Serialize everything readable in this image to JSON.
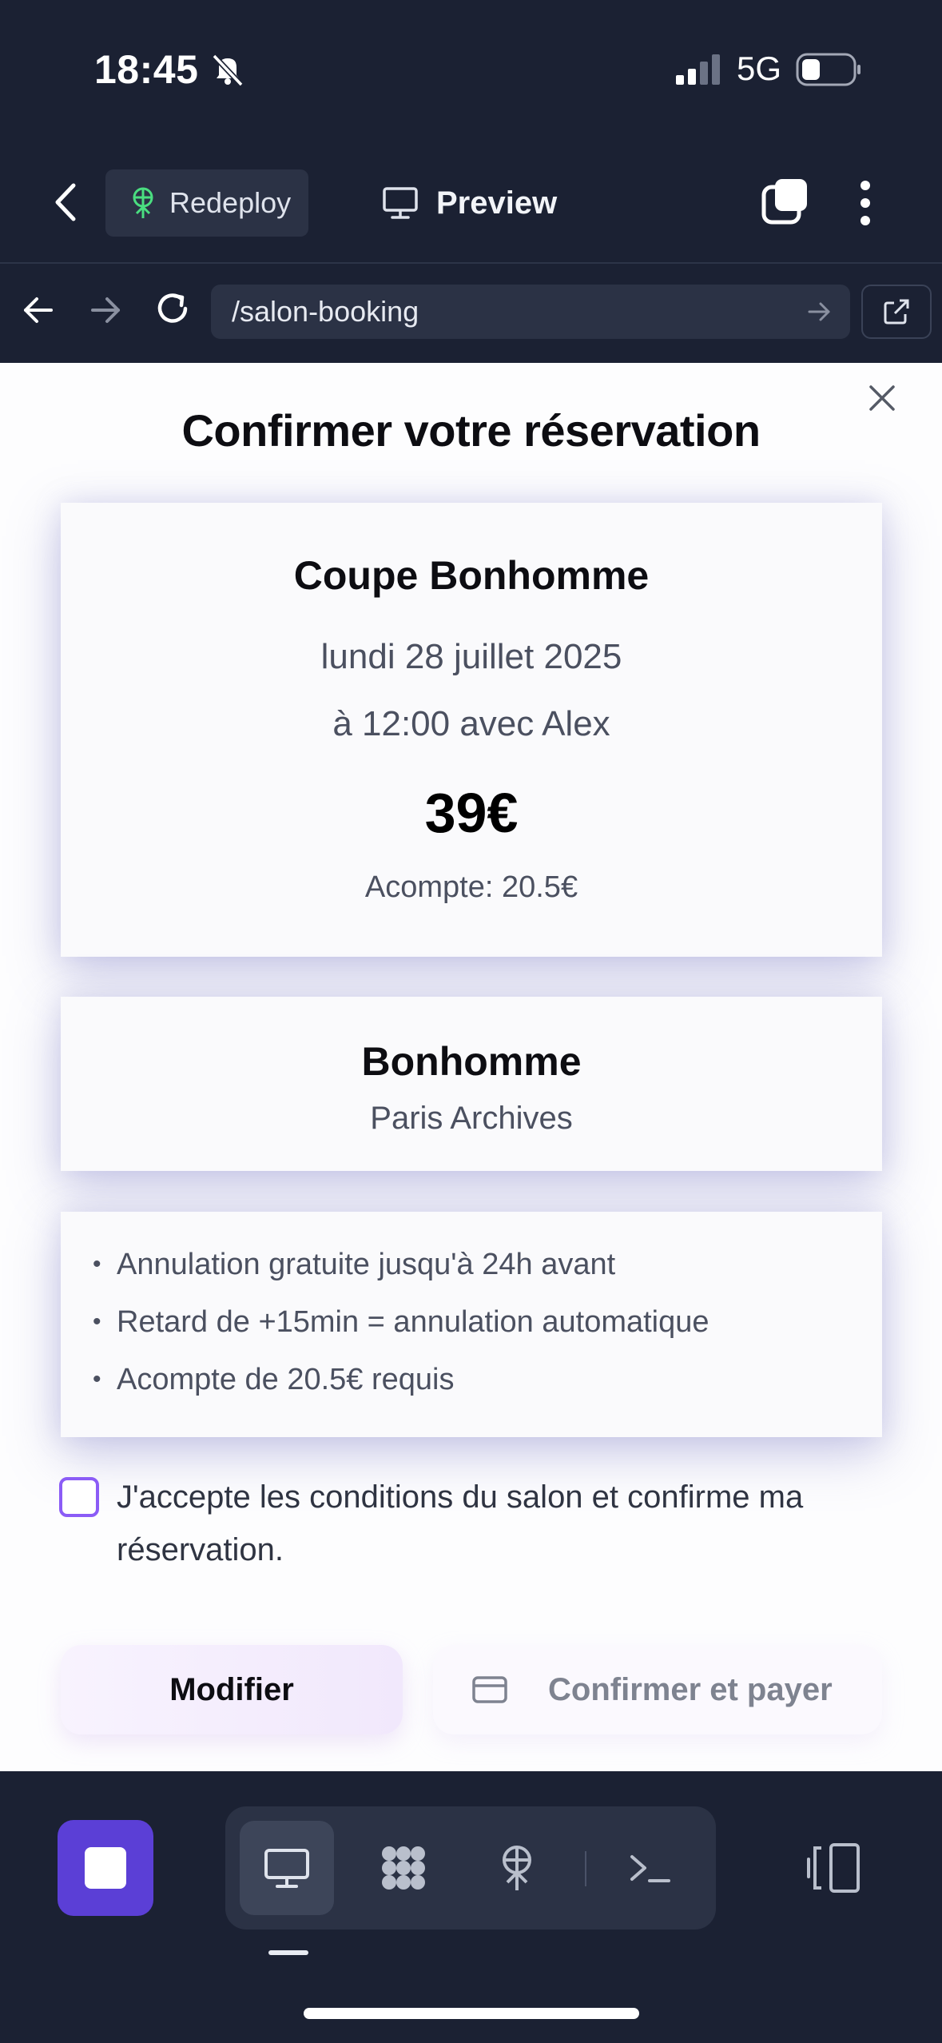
{
  "status_bar": {
    "time": "18:45",
    "network": "5G",
    "icons": [
      "bell-slash-icon",
      "signal-icon",
      "battery-icon"
    ]
  },
  "app_header": {
    "redeploy_label": "Redeploy",
    "preview_label": "Preview",
    "icons": [
      "chevron-left-icon",
      "antenna-icon",
      "monitor-icon",
      "tabs-icon",
      "kebab-menu-icon"
    ]
  },
  "browser": {
    "url": "/salon-booking",
    "icons": [
      "arrow-left-icon",
      "arrow-right-icon",
      "reload-icon",
      "arrow-right-icon",
      "external-link-icon"
    ]
  },
  "modal": {
    "title": "Confirmer votre réservation",
    "service": {
      "name": "Coupe Bonhomme",
      "date": "lundi 28 juillet 2025",
      "time_with": "à 12:00 avec Alex",
      "price": "39€",
      "deposit": "Acompte: 20.5€"
    },
    "salon": {
      "name": "Bonhomme",
      "location": "Paris Archives"
    },
    "rules": [
      "Annulation gratuite jusqu'à 24h avant",
      "Retard de +15min = annulation automatique",
      "Acompte de 20.5€ requis"
    ],
    "consent_text": "J'accepte les conditions du salon et confirme ma réservation.",
    "consent_checked": false,
    "modify_label": "Modifier",
    "confirm_label": "Confirmer et payer"
  },
  "toolbar": {
    "accent_color": "#5b3fd6",
    "items": [
      "stop-icon",
      "monitor-icon",
      "apps-grid-icon",
      "antenna-icon",
      "terminal-icon",
      "panel-icon"
    ],
    "active_item": "monitor-icon"
  },
  "colors": {
    "background": "#1b2133",
    "surface": "#2b3245",
    "checkbox_border": "#8b5cf6"
  }
}
